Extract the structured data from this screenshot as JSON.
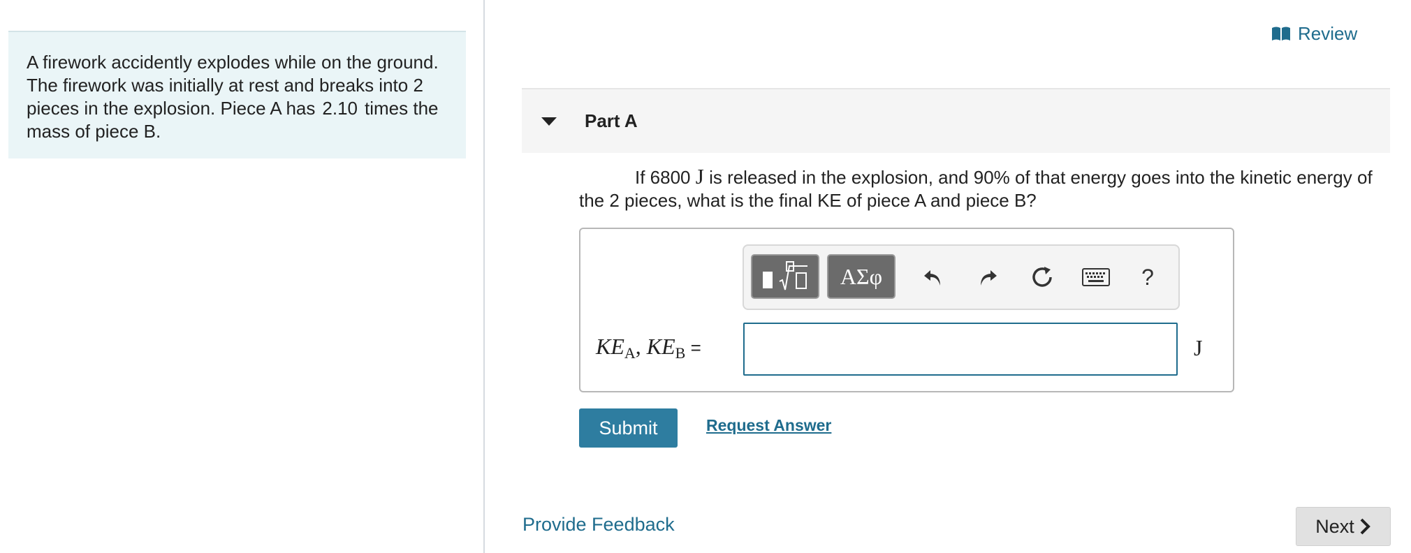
{
  "intro": {
    "text_before": "A firework accidently explodes while on the ground. The firework was initially at rest and breaks into 2 pieces in the explosion. Piece A has",
    "value": "2.10",
    "text_after": "times the mass of piece B."
  },
  "review": {
    "label": "Review",
    "icon": "book-icon"
  },
  "part": {
    "title": "Part A",
    "icon": "caret-down-icon"
  },
  "question": {
    "pre": "If 6800",
    "unit": "J",
    "post": "is released in the explosion, and 90% of that energy goes into the kinetic energy of the 2 pieces, what is the final KE of piece A and piece B?"
  },
  "toolbar": {
    "templates_icon": "fraction-root-templates-icon",
    "greek_label": "ΑΣφ",
    "undo_icon": "undo-icon",
    "redo_icon": "redo-icon",
    "reset_icon": "reset-icon",
    "keyboard_icon": "keyboard-icon",
    "help_label": "?"
  },
  "answer": {
    "label_parts": {
      "ke": "KE",
      "sub_a": "A",
      "sep": ", ",
      "sub_b": "B",
      "eq": " ="
    },
    "value": "",
    "unit": "J"
  },
  "actions": {
    "submit": "Submit",
    "request_answer": "Request Answer",
    "provide_feedback": "Provide Feedback",
    "next": "Next"
  },
  "colors": {
    "accent": "#1f6c8d",
    "submit_bg": "#2e7da0",
    "intro_bg": "#eaf5f7"
  }
}
